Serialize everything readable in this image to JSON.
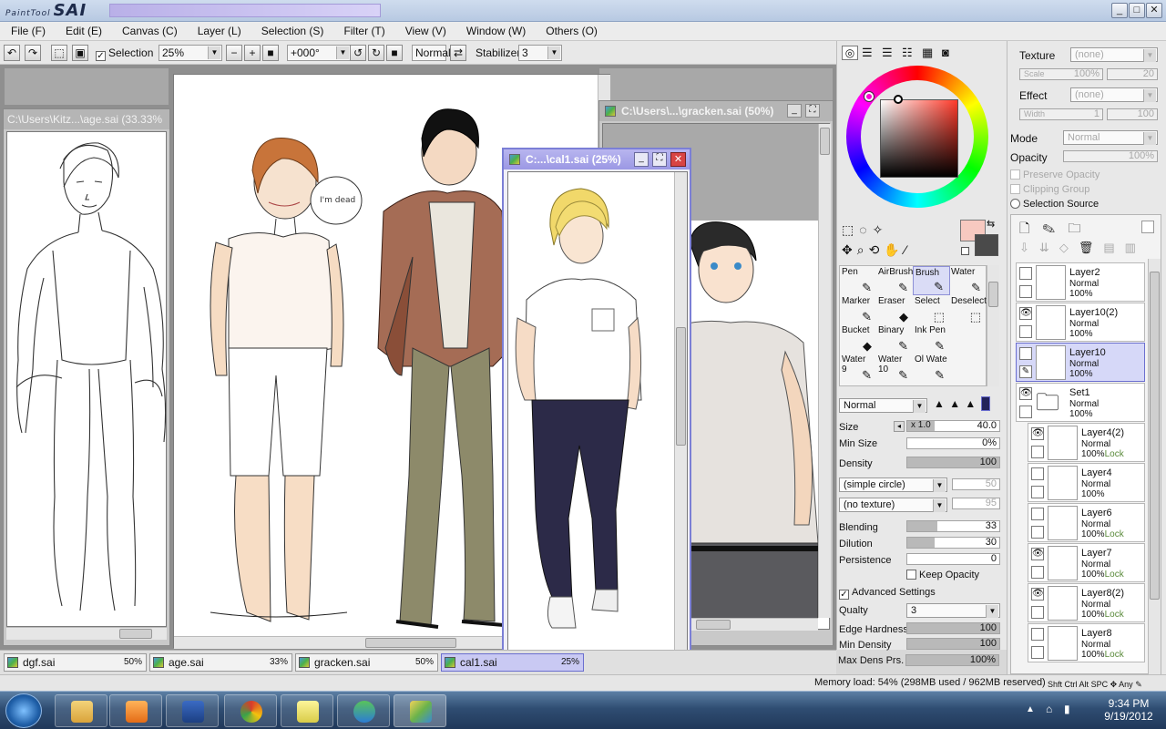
{
  "app": {
    "logo_small": "PaintTool",
    "logo_big": "SAI"
  },
  "window_controls": {
    "minimize": "_",
    "maximize": "□",
    "close": "✕"
  },
  "menu": [
    "File (F)",
    "Edit (E)",
    "Canvas (C)",
    "Layer (L)",
    "Selection (S)",
    "Filter (T)",
    "View (V)",
    "Window (W)",
    "Others (O)"
  ],
  "toolbar": {
    "selection_label": "Selection",
    "selection_checked": "✓",
    "zoom": "25%",
    "rotation": "+000°",
    "mode": "Normal",
    "stabilizer_label": "Stabilizer",
    "stabilizer_value": "3"
  },
  "windows": {
    "age": "C:\\Users\\Kitz...\\age.sai (33.33%",
    "gracken": "C:\\Users\\...\\gracken.sai (50%)",
    "cal1": "C:...\\cal1.sai (25%)"
  },
  "speech_bubble": "I'm dead",
  "color_panel": {
    "primary_color": "#f7c9c0",
    "secondary_color": "#4a4a4a"
  },
  "tools": [
    {
      "name": "Pen",
      "icon": "pen-icon",
      "glyph": "✎"
    },
    {
      "name": "AirBrush",
      "icon": "airbrush-icon",
      "glyph": "✎"
    },
    {
      "name": "Brush",
      "icon": "brush-icon",
      "glyph": "✎"
    },
    {
      "name": "Water",
      "icon": "water-icon",
      "glyph": "✎"
    },
    {
      "name": "Marker",
      "icon": "marker-icon",
      "glyph": "✎"
    },
    {
      "name": "Eraser",
      "icon": "eraser-icon",
      "glyph": "◆"
    },
    {
      "name": "Select",
      "icon": "select-icon",
      "glyph": "⬚"
    },
    {
      "name": "Deselect",
      "icon": "deselect-icon",
      "glyph": "⬚"
    },
    {
      "name": "Bucket",
      "icon": "bucket-icon",
      "glyph": "◆"
    },
    {
      "name": "Binary",
      "icon": "binary-pen-icon",
      "glyph": "✎"
    },
    {
      "name": "Ink Pen",
      "icon": "ink-pen-icon",
      "glyph": "✎"
    },
    {
      "name": "",
      "icon": "empty-slot-icon",
      "glyph": ""
    },
    {
      "name": "Water\n9",
      "icon": "water9-icon",
      "glyph": "✎"
    },
    {
      "name": "Water\n10",
      "icon": "water10-icon",
      "glyph": "✎"
    },
    {
      "name": "Ol Wate",
      "icon": "oil-water-icon",
      "glyph": "✎"
    },
    {
      "name": "",
      "icon": "empty-slot-icon",
      "glyph": ""
    }
  ],
  "brush": {
    "blend_mode": "Normal",
    "size_label": "Size",
    "size_mult": "x 1.0",
    "size_value": "40.0",
    "min_size_label": "Min Size",
    "min_size_value": "0%",
    "density_label": "Density",
    "density_value": "100",
    "density_pct": 100,
    "shape": "(simple circle)",
    "shape_value": "50",
    "texture": "(no texture)",
    "texture_value": "95",
    "blending_label": "Blending",
    "blending_value": "33",
    "blending_pct": 33,
    "dilution_label": "Dilution",
    "dilution_value": "30",
    "dilution_pct": 30,
    "persistence_label": "Persistence",
    "persistence_value": "0",
    "persistence_pct": 0,
    "keep_opacity_label": "Keep Opacity",
    "advanced_label": "Advanced Settings",
    "quality_label": "Qualty",
    "quality_value": "3",
    "edge_label": "Edge Hardness",
    "edge_value": "100",
    "edge_pct": 100,
    "min_density_label": "Min Density",
    "min_density_value": "100",
    "min_density_pct": 100,
    "max_dens_label": "Max Dens Prs.",
    "max_dens_value": "100%",
    "max_dens_pct": 100
  },
  "layer_props": {
    "texture_label": "Texture",
    "texture_value": "(none)",
    "scale_label": "Scale",
    "scale_value": "100%",
    "scale_num": "20",
    "effect_label": "Effect",
    "effect_value": "(none)",
    "width_label": "Width",
    "width_value": "1",
    "width_num": "100",
    "mode_label": "Mode",
    "mode_value": "Normal",
    "opacity_label": "Opacity",
    "opacity_value": "100%",
    "preserve_label": "Preserve Opacity",
    "clipping_label": "Clipping Group",
    "selsource_label": "Selection Source"
  },
  "layers": [
    {
      "name": "Layer2",
      "mode": "Normal",
      "opacity": "100%",
      "lock": "",
      "visible": "",
      "selected": false,
      "indent": 0
    },
    {
      "name": "Layer10(2)",
      "mode": "Normal",
      "opacity": "100%",
      "lock": "",
      "visible": "👁",
      "selected": false,
      "indent": 0
    },
    {
      "name": "Layer10",
      "mode": "Normal",
      "opacity": "100%",
      "lock": "",
      "visible": "",
      "selected": true,
      "indent": 0
    },
    {
      "name": "Set1",
      "mode": "Normal",
      "opacity": "100%",
      "lock": "",
      "visible": "👁",
      "selected": false,
      "indent": 0,
      "folder": true
    },
    {
      "name": "Layer4(2)",
      "mode": "Normal",
      "opacity": "100%",
      "lock": "Lock",
      "visible": "👁",
      "selected": false,
      "indent": 1
    },
    {
      "name": "Layer4",
      "mode": "Normal",
      "opacity": "100%",
      "lock": "",
      "visible": "",
      "selected": false,
      "indent": 1
    },
    {
      "name": "Layer6",
      "mode": "Normal",
      "opacity": "100%",
      "lock": "Lock",
      "visible": "",
      "selected": false,
      "indent": 1
    },
    {
      "name": "Layer7",
      "mode": "Normal",
      "opacity": "100%",
      "lock": "Lock",
      "visible": "👁",
      "selected": false,
      "indent": 1
    },
    {
      "name": "Layer8(2)",
      "mode": "Normal",
      "opacity": "100%",
      "lock": "Lock",
      "visible": "👁",
      "selected": false,
      "indent": 1
    },
    {
      "name": "Layer8",
      "mode": "Normal",
      "opacity": "100%",
      "lock": "Lock",
      "visible": "",
      "selected": false,
      "indent": 1
    }
  ],
  "tabs": [
    {
      "name": "dgf.sai",
      "pct": "50%",
      "active": false
    },
    {
      "name": "age.sai",
      "pct": "33%",
      "active": false
    },
    {
      "name": "gracken.sai",
      "pct": "50%",
      "active": false
    },
    {
      "name": "cal1.sai",
      "pct": "25%",
      "active": true
    }
  ],
  "status": {
    "memory": "Memory load: 54% (298MB used / 962MB reserved)",
    "keys": [
      "Shft",
      "Ctrl",
      "Alt",
      "SPC",
      "Any"
    ]
  },
  "taskbar": {
    "time": "9:34 PM",
    "date": "9/19/2012"
  }
}
